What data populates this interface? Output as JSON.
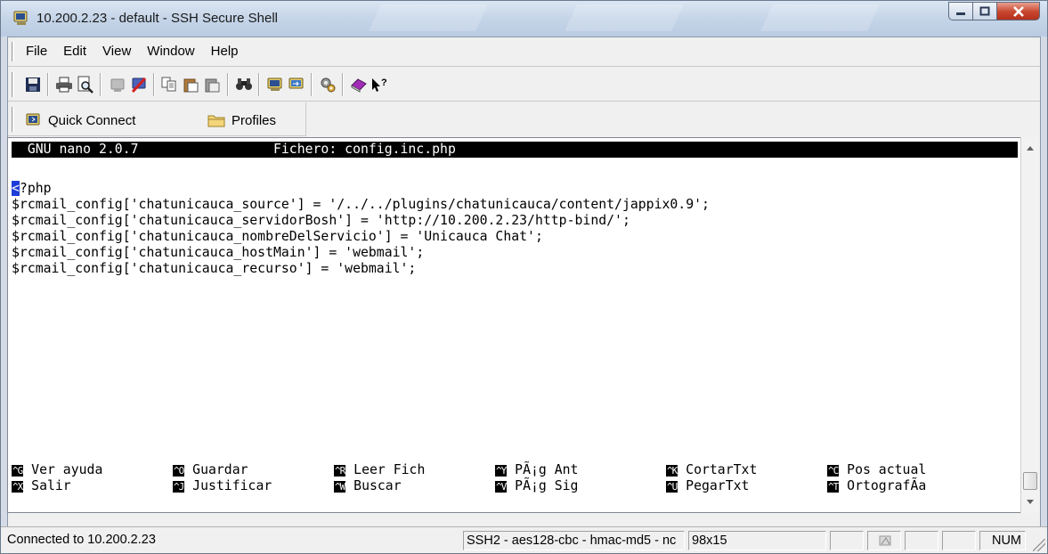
{
  "window": {
    "title": "10.200.2.23 - default - SSH Secure Shell"
  },
  "menu": [
    "File",
    "Edit",
    "View",
    "Window",
    "Help"
  ],
  "toolbar_icons": [
    "save-icon",
    "print-icon",
    "print-preview-icon",
    "disconnect-icon",
    "disconnect-x-icon",
    "copy-icon",
    "paste-icon",
    "paste-special-icon",
    "find-icon",
    "new-terminal-icon",
    "new-file-transfer-icon",
    "settings-icon",
    "help-book-icon",
    "context-help-icon"
  ],
  "quick_bar": {
    "quick_connect": "Quick Connect",
    "profiles": "Profiles"
  },
  "terminal": {
    "header": "  GNU nano 2.0.7                 Fichero: config.inc.php",
    "cursor_char": "<",
    "first_line_rest": "?php",
    "lines": [
      "$rcmail_config['chatunicauca_source'] = '/../../plugins/chatunicauca/content/jappix0.9';",
      "$rcmail_config['chatunicauca_servidorBosh'] = 'http://10.200.2.23/http-bind/';",
      "$rcmail_config['chatunicauca_nombreDelServicio'] = 'Unicauca Chat';",
      "$rcmail_config['chatunicauca_hostMain'] = 'webmail';",
      "$rcmail_config['chatunicauca_recurso'] = 'webmail';"
    ],
    "shortcuts_row1": [
      {
        "key": "^G",
        "label": "Ver ayuda"
      },
      {
        "key": "^O",
        "label": "Guardar"
      },
      {
        "key": "^R",
        "label": "Leer Fich"
      },
      {
        "key": "^Y",
        "label": "PÃ¡g Ant"
      },
      {
        "key": "^K",
        "label": "CortarTxt"
      },
      {
        "key": "^C",
        "label": "Pos actual"
      }
    ],
    "shortcuts_row2": [
      {
        "key": "^X",
        "label": "Salir"
      },
      {
        "key": "^J",
        "label": "Justificar"
      },
      {
        "key": "^W",
        "label": "Buscar"
      },
      {
        "key": "^V",
        "label": "PÃ¡g Sig"
      },
      {
        "key": "^U",
        "label": "PegarTxt"
      },
      {
        "key": "^T",
        "label": "OrtografÃ­a"
      }
    ]
  },
  "status": {
    "connection": "Connected to 10.200.2.23",
    "cipher": "SSH2 - aes128-cbc - hmac-md5 - nc",
    "size": "98x15",
    "num": "NUM"
  },
  "colors": {
    "title_gradient": "#c7d6e9",
    "close_button": "#c7452d",
    "terminal_bg": "#ffffff",
    "nano_header_bg": "#000000",
    "cursor": "#1e3cd6"
  }
}
